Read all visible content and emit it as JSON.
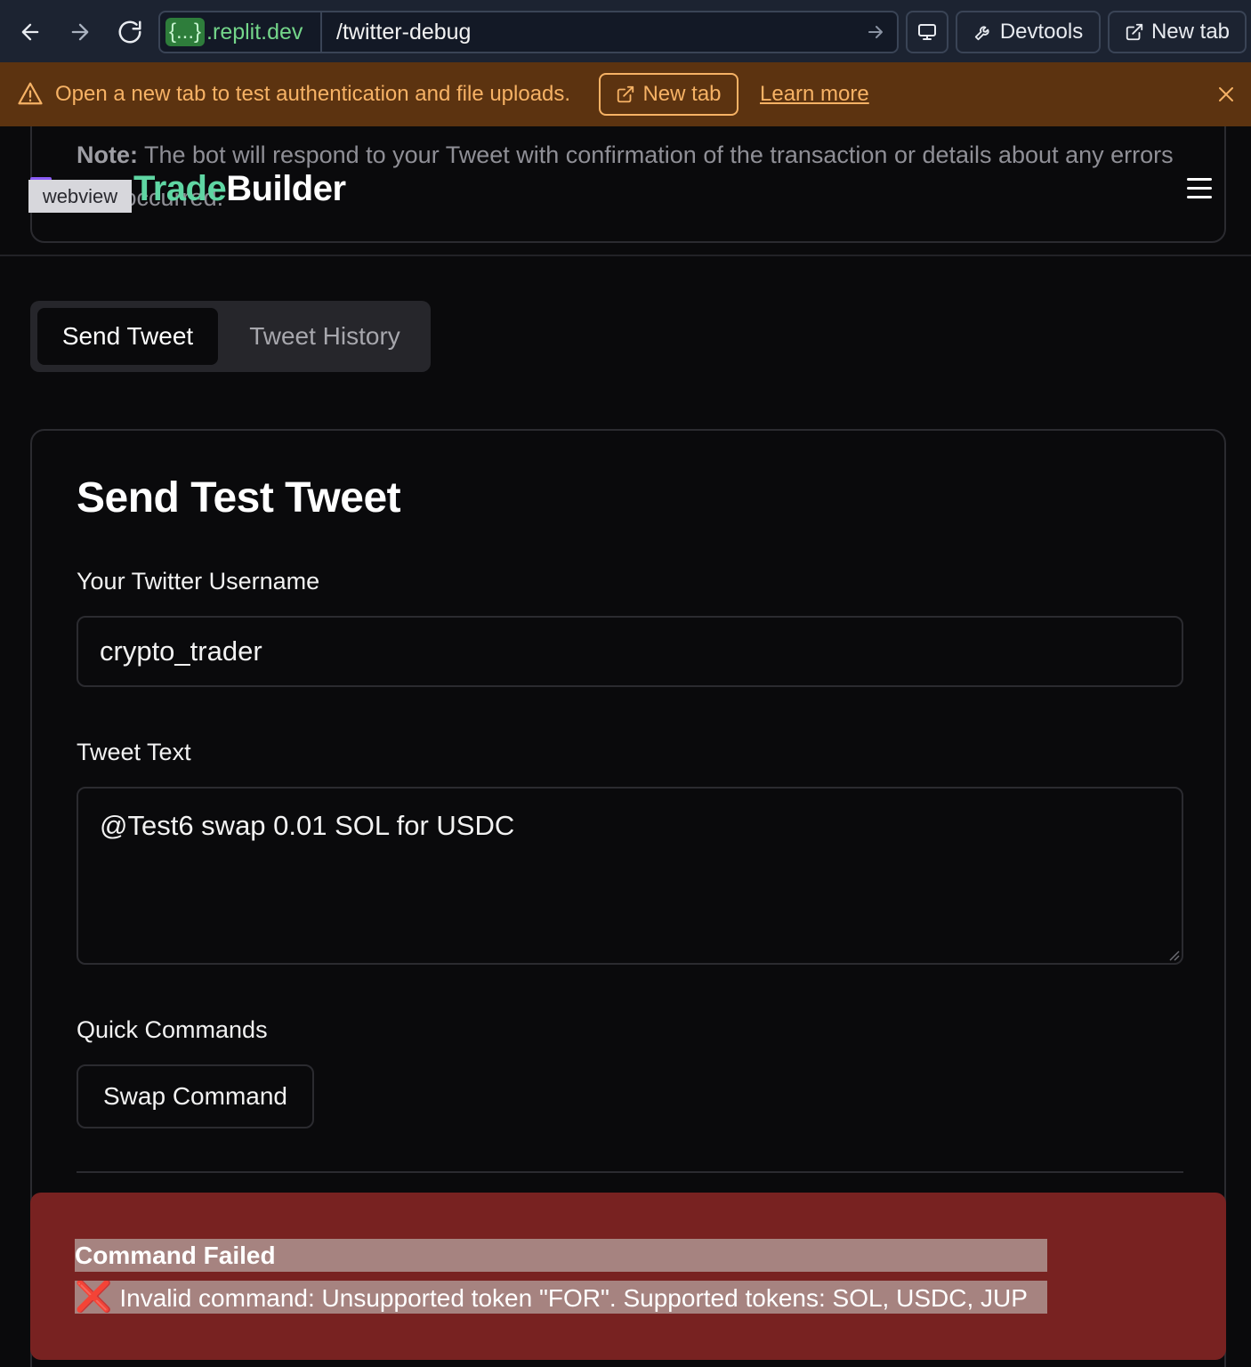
{
  "browser": {
    "host_prefix": "{...}",
    "host": ".replit.dev",
    "path": "/twitter-debug",
    "devtools_label": "Devtools",
    "newtab_label": "New tab"
  },
  "banner": {
    "message": "Open a new tab to test authentication and file uploads.",
    "newtab_label": "New tab",
    "learn_more": "Learn more"
  },
  "note": {
    "label": "Note:",
    "text": " The bot will respond to your Tweet with confirmation of the transaction or details about any errors that occurred."
  },
  "header": {
    "logo_part1": "Trade",
    "logo_part2": "Builder",
    "webview_tag": "webview"
  },
  "tabs": [
    {
      "label": "Send Tweet",
      "active": true
    },
    {
      "label": "Tweet History",
      "active": false
    }
  ],
  "form": {
    "title": "Send Test Tweet",
    "username_label": "Your Twitter Username",
    "username_value": "crypto_trader",
    "tweet_label": "Tweet Text",
    "tweet_value": "@Test6 swap 0.01 SOL for USDC",
    "quick_commands_label": "Quick Commands",
    "swap_command_label": "Swap Command"
  },
  "error": {
    "title": "Command Failed",
    "icon": "❌",
    "message": "Invalid command: Unsupported token \"FOR\". Supported tokens: SOL, USDC, JUP"
  },
  "colors": {
    "banner_bg": "#5c3310",
    "banner_fg": "#f6b265",
    "logo_accent": "#5fd6a3",
    "error_bg": "#782221"
  }
}
